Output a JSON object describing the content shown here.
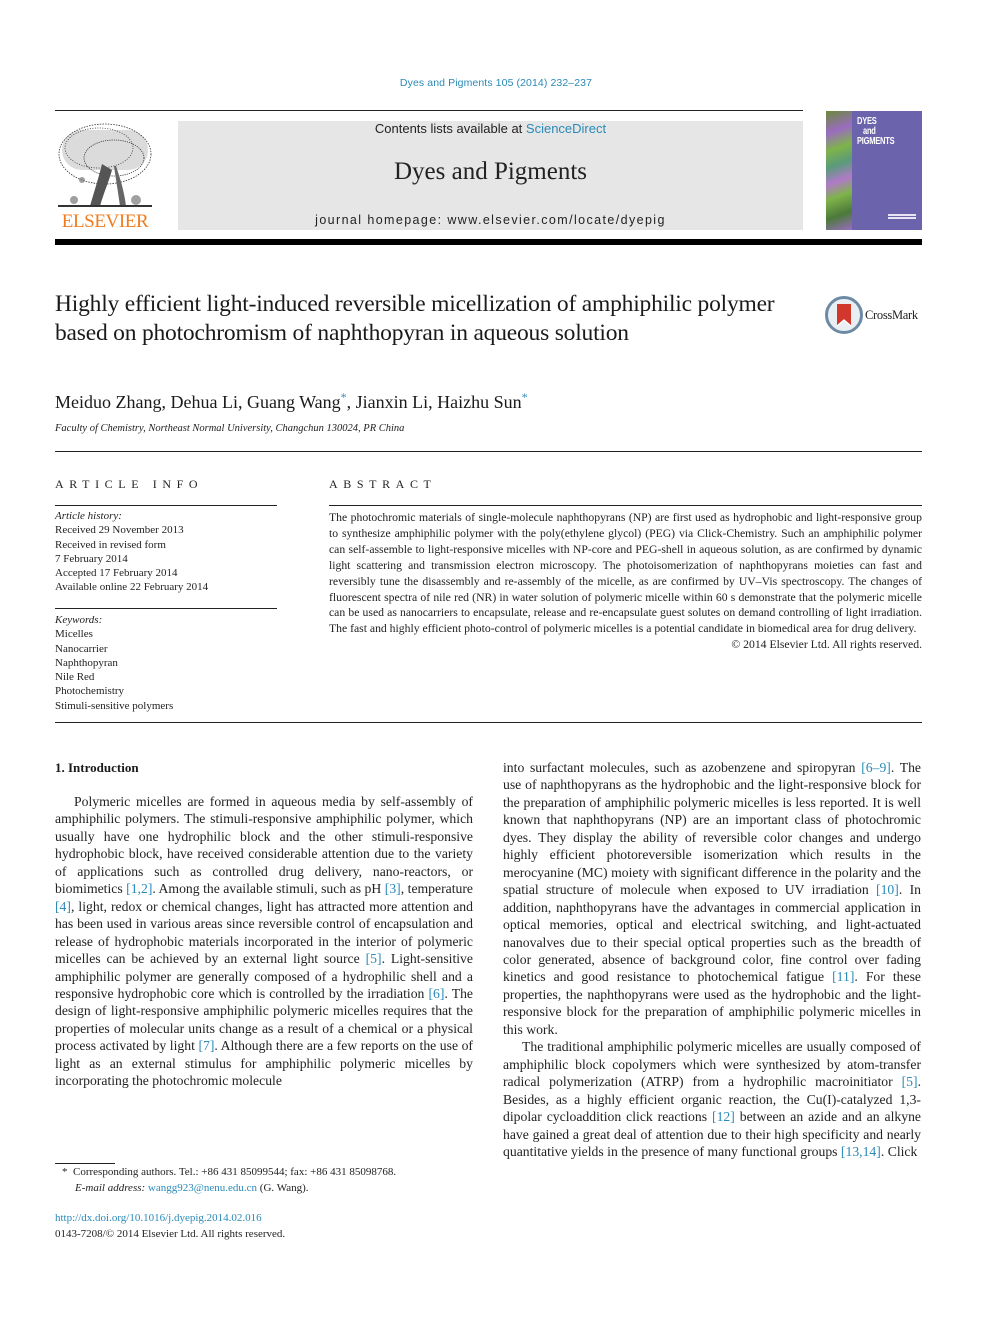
{
  "header": {
    "journal_ref": "Dyes and Pigments 105 (2014) 232–237",
    "contents_prefix": "Contents lists available at ",
    "contents_link": "ScienceDirect",
    "journal_name": "Dyes and Pigments",
    "homepage": "journal homepage: www.elsevier.com/locate/dyepig",
    "publisher_logo": "ELSEVIER",
    "cover_title_lines": [
      "DYES",
      "and",
      "PIGMENTS"
    ],
    "crossmark_label": "CrossMark"
  },
  "article": {
    "title": "Highly efficient light-induced reversible micellization of amphiphilic polymer based on photochromism of naphthopyran in aqueous solution",
    "authors": [
      {
        "name": "Meiduo Zhang",
        "corresponding": false
      },
      {
        "name": "Dehua Li",
        "corresponding": false
      },
      {
        "name": "Guang Wang",
        "corresponding": true
      },
      {
        "name": "Jianxin Li",
        "corresponding": false
      },
      {
        "name": "Haizhu Sun",
        "corresponding": true
      }
    ],
    "corresponding_mark": "*",
    "affiliation": "Faculty of Chemistry, Northeast Normal University, Changchun 130024, PR China"
  },
  "article_info": {
    "heading": "ARTICLE INFO",
    "history_label": "Article history:",
    "history": [
      "Received 29 November 2013",
      "Received in revised form",
      "7 February 2014",
      "Accepted 17 February 2014",
      "Available online 22 February 2014"
    ],
    "keywords_label": "Keywords:",
    "keywords": [
      "Micelles",
      "Nanocarrier",
      "Naphthopyran",
      "Nile Red",
      "Photochemistry",
      "Stimuli-sensitive polymers"
    ]
  },
  "abstract": {
    "heading": "ABSTRACT",
    "text": "The photochromic materials of single-molecule naphthopyrans (NP) are first used as hydrophobic and light-responsive group to synthesize amphiphilic polymer with the poly(ethylene glycol) (PEG) via Click-Chemistry. Such an amphiphilic polymer can self-assemble to light-responsive micelles with NP-core and PEG-shell in aqueous solution, as are confirmed by dynamic light scattering and transmission electron microscopy. The photoisomerization of naphthopyrans moieties can fast and reversibly tune the disassembly and re-assembly of the micelle, as are confirmed by UV–Vis spectroscopy. The changes of fluorescent spectra of nile red (NR) in water solution of polymeric micelle within 60 s demonstrate that the polymeric micelle can be used as nanocarriers to encapsulate, release and re-encapsulate guest solutes on demand controlling of light irradiation. The fast and highly efficient photo-control of polymeric micelles is a potential candidate in biomedical area for drug delivery.",
    "copyright": "© 2014 Elsevier Ltd. All rights reserved."
  },
  "body": {
    "section_heading": "1.  Introduction",
    "left_column": [
      {
        "t": "Polymeric micelles are formed in aqueous media by self-assembly of amphiphilic polymers. The stimuli-responsive amphiphilic polymer, which usually have one hydrophilic block and the other stimuli-responsive hydrophobic block, have received considerable attention due to the variety of applications such as controlled drug delivery, nano-reactors, or biomimetics "
      },
      {
        "ref": "[1,2]"
      },
      {
        "t": ". Among the available stimuli, such as pH "
      },
      {
        "ref": "[3]"
      },
      {
        "t": ", temperature "
      },
      {
        "ref": "[4]"
      },
      {
        "t": ", light, redox or chemical changes, light has attracted more attention and has been used in various areas since reversible control of encapsulation and release of hydrophobic materials incorporated in the interior of polymeric micelles can be achieved by an external light source "
      },
      {
        "ref": "[5]"
      },
      {
        "t": ". Light-sensitive amphiphilic polymer are generally composed of a hydrophilic shell and a responsive hydrophobic core which is controlled by the irradiation "
      },
      {
        "ref": "[6]"
      },
      {
        "t": ". The design of light-responsive amphiphilic polymeric micelles requires that the properties of molecular units change as a result of a chemical or a physical process activated by light "
      },
      {
        "ref": "[7]"
      },
      {
        "t": ". Although there are a few reports on the use of light as an external stimulus for amphiphilic polymeric micelles by incorporating the photochromic molecule"
      }
    ],
    "right_column_p1": [
      {
        "t": "into surfactant molecules, such as azobenzene and spiropyran "
      },
      {
        "ref": "[6–9]"
      },
      {
        "t": ". The use of naphthopyrans as the hydrophobic and the light-responsive block for the preparation of amphiphilic polymeric micelles is less reported. It is well known that naphthopyrans (NP) are an important class of photochromic dyes. They display the ability of reversible color changes and undergo highly efficient photoreversible isomerization which results in the merocyanine (MC) moiety with significant difference in the polarity and the spatial structure of molecule when exposed to UV irradiation "
      },
      {
        "ref": "[10]"
      },
      {
        "t": ". In addition, naphthopyrans have the advantages in commercial application in optical memories, optical and electrical switching, and light-actuated nanovalves due to their special optical properties such as the breadth of color generated, absence of background color, fine control over fading kinetics and good resistance to photochemical fatigue "
      },
      {
        "ref": "[11]"
      },
      {
        "t": ". For these properties, the naphthopyrans were used as the hydrophobic and the light-responsive block for the preparation of amphiphilic polymeric micelles in this work."
      }
    ],
    "right_column_p2": [
      {
        "t": "The traditional amphiphilic polymeric micelles are usually composed of amphiphilic block copolymers which were synthesized by atom-transfer radical polymerization (ATRP) from a hydrophilic macroinitiator "
      },
      {
        "ref": "[5]"
      },
      {
        "t": ". Besides, as a highly efficient organic reaction, the Cu(I)-catalyzed 1,3-dipolar cycloaddition click reactions "
      },
      {
        "ref": "[12]"
      },
      {
        "t": " between an azide and an alkyne have gained a great deal of attention due to their high specificity and nearly quantitative yields in the presence of many functional groups "
      },
      {
        "ref": "[13,14]"
      },
      {
        "t": ". Click"
      }
    ]
  },
  "footnote": {
    "mark": "*",
    "corresponding": "Corresponding authors. Tel.: +86 431 85099544; fax: +86 431 85098768.",
    "email_label": "E-mail address: ",
    "email": "wangg923@nenu.edu.cn",
    "email_suffix": " (G. Wang)."
  },
  "doi": {
    "link": "http://dx.doi.org/10.1016/j.dyepig.2014.02.016",
    "issn_line": "0143-7208/© 2014 Elsevier Ltd. All rights reserved."
  },
  "colors": {
    "link": "#2a8ab8",
    "elsevier_orange": "#f07b1c",
    "masthead_bg": "#e6e6e6",
    "cover_purple": "#6c63ad"
  }
}
